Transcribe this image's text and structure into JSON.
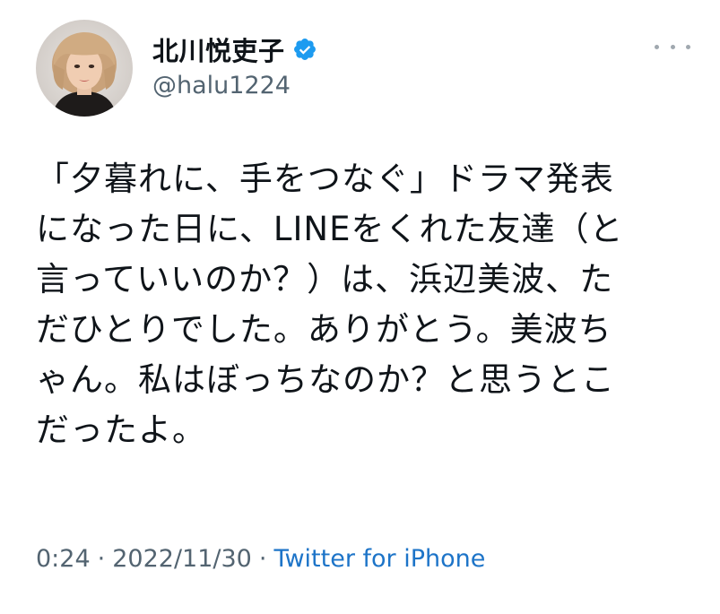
{
  "user": {
    "display_name": "北川悦吏子",
    "handle": "@halu1224",
    "verified": true
  },
  "tweet": {
    "text": "「夕暮れに、手をつなぐ」ドラマ発表\nになった日に、LINEをくれた友達（と\n言っていいのか？）は、浜辺美波、た\nだひとりでした。ありがとう。美波ち\nゃん。私はぼっちなのか？と思うとこ\nだったよ。"
  },
  "meta": {
    "time": "0:24",
    "separator": "·",
    "date": "2022/11/30",
    "source": "Twitter for iPhone"
  },
  "colors": {
    "verified_badge": "#1d9bf0",
    "source_link": "#1d74c8",
    "secondary_text": "#536471"
  },
  "icons": {
    "verified": "verified-badge-icon",
    "more": "more-options-icon"
  }
}
